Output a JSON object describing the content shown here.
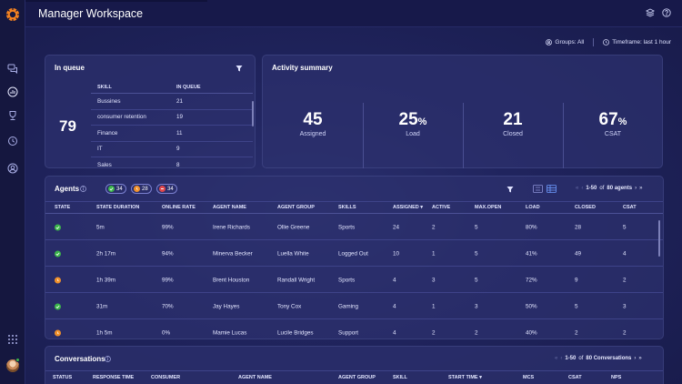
{
  "app": {
    "title": "Manager Workspace"
  },
  "filters": {
    "groups": "Groups: All",
    "timeframe": "Timeframe: last 1 hour"
  },
  "queue": {
    "title": "In queue",
    "total": "79",
    "headers": [
      "SKILL",
      "IN QUEUE"
    ],
    "rows": [
      [
        "Bussines",
        "21"
      ],
      [
        "consumer retention",
        "19"
      ],
      [
        "Finance",
        "11"
      ],
      [
        "IT",
        "9"
      ],
      [
        "Sales",
        "8"
      ]
    ]
  },
  "activity": {
    "title": "Activity summary",
    "items": [
      {
        "value": "45",
        "unit": "",
        "label": "Assigned"
      },
      {
        "value": "25",
        "unit": "%",
        "label": "Load"
      },
      {
        "value": "21",
        "unit": "",
        "label": "Closed"
      },
      {
        "value": "67",
        "unit": "%",
        "label": "CSAT"
      }
    ]
  },
  "agents": {
    "title": "Agents",
    "counts": {
      "online": "34",
      "away": "28",
      "busy": "34"
    },
    "pager": {
      "range": "1-50",
      "of": "of",
      "total": "80 agents"
    },
    "headers": [
      "STATE",
      "STATE DURATION",
      "ONLINE RATE",
      "AGENT NAME",
      "AGENT GROUP",
      "SKILLS",
      "ASSIGNED",
      "ACTIVE",
      "MAX.OPEN",
      "LOAD",
      "CLOSED",
      "CSAT"
    ],
    "rows": [
      {
        "state": "online",
        "duration": "5m",
        "rate": "99%",
        "name": "Irene Richards",
        "group": "Ollie Greene",
        "skills": "Sports",
        "assigned": "24",
        "active": "2",
        "maxopen": "5",
        "load": "80%",
        "closed": "28",
        "csat": "5"
      },
      {
        "state": "online",
        "duration": "2h 17m",
        "rate": "94%",
        "name": "Minerva Becker",
        "group": "Luella White",
        "skills": "Logged Out",
        "assigned": "10",
        "active": "1",
        "maxopen": "5",
        "load": "41%",
        "closed": "49",
        "csat": "4"
      },
      {
        "state": "away",
        "duration": "1h 39m",
        "rate": "99%",
        "name": "Brent Houston",
        "group": "Randall Wright",
        "skills": "Sports",
        "assigned": "4",
        "active": "3",
        "maxopen": "5",
        "load": "72%",
        "closed": "9",
        "csat": "2"
      },
      {
        "state": "online",
        "duration": "31m",
        "rate": "70%",
        "name": "Jay Hayes",
        "group": "Tony Cox",
        "skills": "Gaming",
        "assigned": "4",
        "active": "1",
        "maxopen": "3",
        "load": "50%",
        "closed": "5",
        "csat": "3"
      },
      {
        "state": "away",
        "duration": "1h 5m",
        "rate": "0%",
        "name": "Mamie Lucas",
        "group": "Lucile Bridges",
        "skills": "Support",
        "assigned": "4",
        "active": "2",
        "maxopen": "2",
        "load": "40%",
        "closed": "2",
        "csat": "2"
      }
    ]
  },
  "conversations": {
    "title": "Conversations",
    "pager": {
      "range": "1-50",
      "of": "of",
      "total": "80 Conversations"
    },
    "headers": [
      "STATUS",
      "RESPONSE TIME",
      "CONSUMER",
      "AGENT NAME",
      "AGENT GROUP",
      "SKILL",
      "START TIME",
      "MCS",
      "CSAT",
      "NPS"
    ]
  },
  "colors": {
    "online": "#3bb54a",
    "away": "#f0902a",
    "busy": "#e0474c",
    "accent": "#f58220"
  }
}
